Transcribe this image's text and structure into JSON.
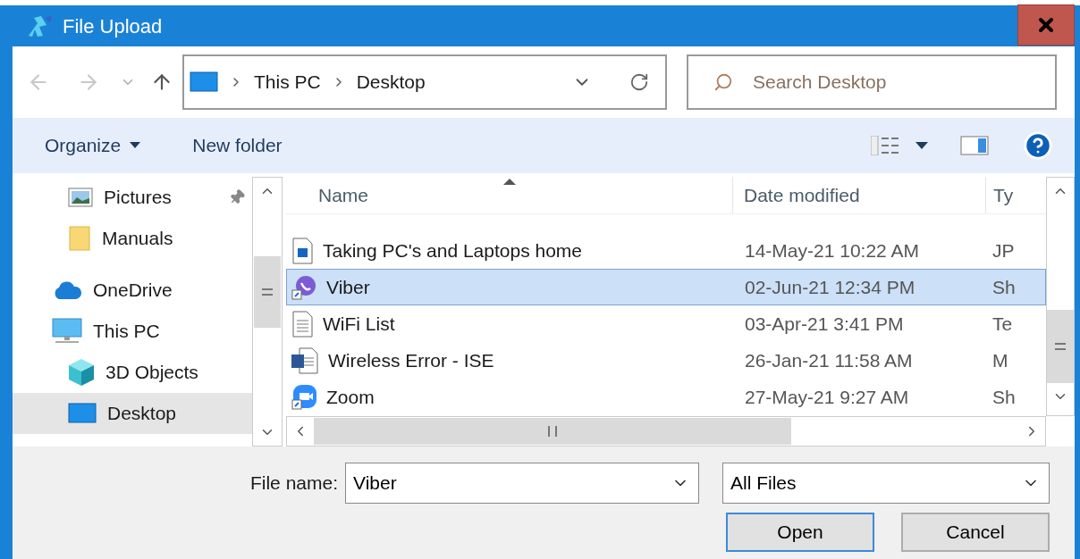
{
  "window": {
    "title": "File Upload"
  },
  "address": {
    "path": [
      "This PC",
      "Desktop"
    ]
  },
  "search": {
    "placeholder": "Search Desktop"
  },
  "toolbar": {
    "organize": "Organize",
    "new_folder": "New folder"
  },
  "nav": {
    "quick_access_items": [
      {
        "label": "Pictures",
        "kind": "pictures",
        "pinned": true,
        "selected": false
      },
      {
        "label": "Manuals",
        "kind": "folder",
        "pinned": false,
        "selected": false
      }
    ],
    "items": [
      {
        "label": "OneDrive",
        "kind": "cloud",
        "selected": false
      },
      {
        "label": "This PC",
        "kind": "pc",
        "selected": false,
        "children": [
          {
            "label": "3D Objects",
            "kind": "cube",
            "selected": false
          },
          {
            "label": "Desktop",
            "kind": "desktop",
            "selected": true
          }
        ]
      }
    ]
  },
  "table": {
    "columns": [
      {
        "label": "Name",
        "sorted": true
      },
      {
        "label": "Date modified",
        "sorted": false
      },
      {
        "label": "Ty",
        "sorted": false
      }
    ],
    "rows": [
      {
        "name": "Taking PC's and Laptops home",
        "date": "14-May-21 10:22 AM",
        "type": "JP",
        "kind": "image",
        "selected": false
      },
      {
        "name": "Viber",
        "date": "02-Jun-21 12:34 PM",
        "type": "Sh",
        "kind": "viber",
        "selected": true
      },
      {
        "name": "WiFi List",
        "date": "03-Apr-21 3:41 PM",
        "type": "Te",
        "kind": "text",
        "selected": false
      },
      {
        "name": "Wireless Error - ISE",
        "date": "26-Jan-21 11:58 AM",
        "type": "M",
        "kind": "word",
        "selected": false
      },
      {
        "name": "Zoom",
        "date": "27-May-21 9:27 AM",
        "type": "Sh",
        "kind": "zoom",
        "selected": false
      }
    ]
  },
  "file_name": {
    "label": "File name:",
    "value": "Viber"
  },
  "filter": {
    "value": "All Files"
  },
  "buttons": [
    {
      "label": "Open",
      "default": true
    },
    {
      "label": "Cancel",
      "default": false
    }
  ]
}
